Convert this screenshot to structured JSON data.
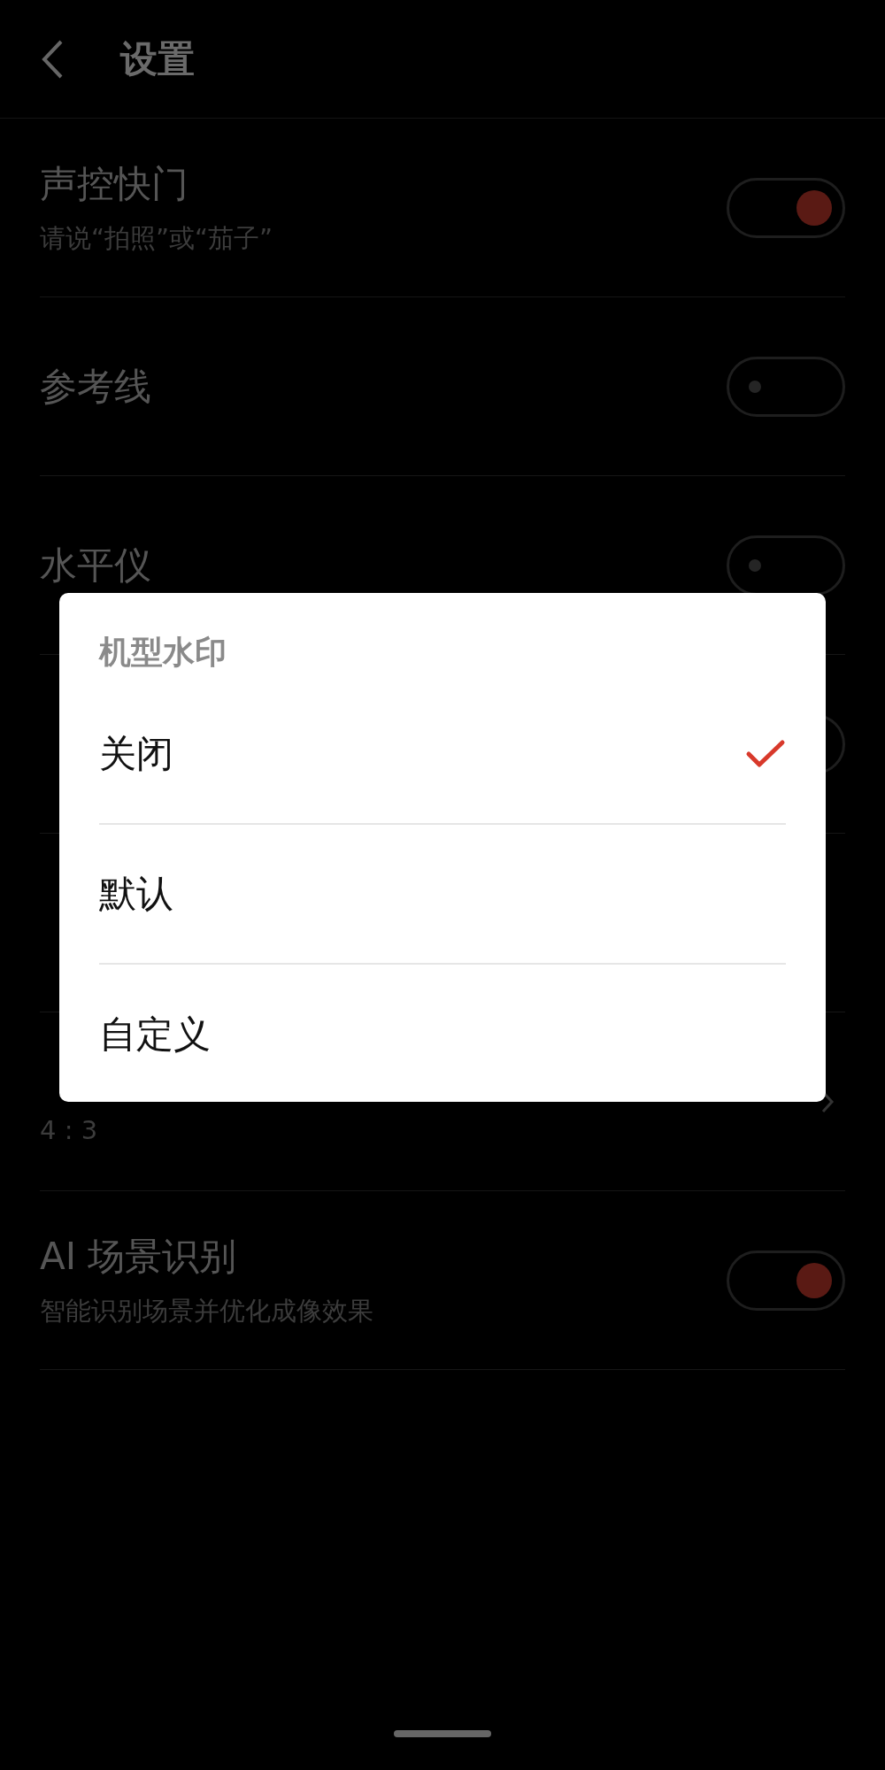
{
  "header": {
    "title": "设置"
  },
  "rows": [
    {
      "title": "声控快门",
      "subtitle": "请说“拍照”或“茄子”",
      "kind": "toggle",
      "on": true
    },
    {
      "title": "参考线",
      "kind": "toggle",
      "on": false
    },
    {
      "title": "水平仪",
      "kind": "toggle",
      "on": false
    },
    {
      "kind": "toggle",
      "on": false
    },
    {
      "kind": "plain"
    },
    {
      "subtitle": "4 : 3",
      "kind": "chevron"
    },
    {
      "title": "AI 场景识别",
      "subtitle": "智能识别场景并优化成像效果",
      "kind": "toggle",
      "on": true
    }
  ],
  "dialog": {
    "title": "机型水印",
    "options": [
      {
        "label": "关闭",
        "selected": true
      },
      {
        "label": "默认",
        "selected": false
      },
      {
        "label": "自定义",
        "selected": false
      }
    ]
  }
}
